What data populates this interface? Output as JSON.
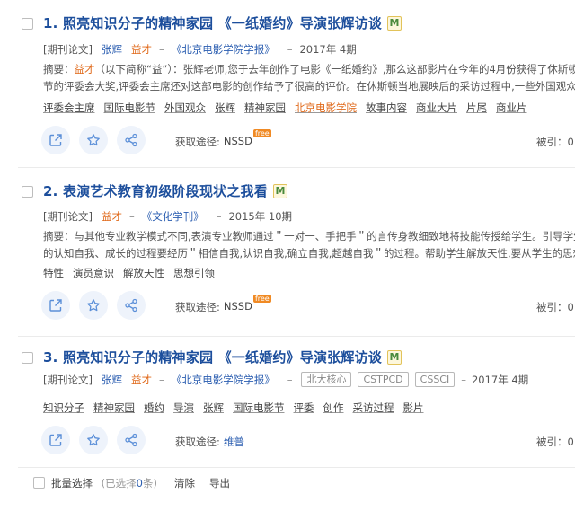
{
  "results": [
    {
      "title": "1. 照亮知识分子的精神家园 《一纸婚约》导演张辉访谈",
      "badge": "M",
      "type": "[期刊论文]",
      "authors": [
        "张辉",
        "益才"
      ],
      "journal": "《北京电影学院学报》",
      "year": "2017年 4期",
      "abstract_label": "摘要：",
      "abstract_hl": "益才",
      "abstract_line1": "（以下简称“益”）：张辉老师,您于去年创作了电影《一纸婚约》,那么这部影片在今年的4月份获得了休斯顿国际电影",
      "abstract_line2": "节的评委会大奖,评委会主席还对这部电影的创作给予了很高的评价。在休斯顿当地展映后的采访过程中,一些外国观众谈到吸引",
      "keywords": [
        "评委会主席",
        "国际电影节",
        "外国观众",
        "张辉",
        "精神家园",
        "北京电影学院",
        "故事内容",
        "商业大片",
        "片尾",
        "商业片"
      ],
      "source_label": "获取途径:",
      "source": "NSSD",
      "source_tag": "free",
      "cited": "被引：0"
    },
    {
      "title": "2. 表演艺术教育初级阶段现状之我看",
      "badge": "M",
      "type": "[期刊论文]",
      "authors": [
        "益才"
      ],
      "journal": "《文化学刊》",
      "year": "2015年 10期",
      "abstract_label": "摘要：",
      "abstract_line1": "与其他专业教学模式不同,表演专业教师通过＂一对一、手把手＂的言传身教细致地将技能传授给学生。引导学生明确演员",
      "abstract_line2": "的认知自我、成长的过程要经历＂相信自我,认识自我,确立自我,超越自我＂的过程。帮助学生解放天性,要从学生的思想、观念…",
      "keywords": [
        "特性",
        "演员意识",
        "解放天性",
        "思想引领"
      ],
      "source_label": "获取途径:",
      "source": "NSSD",
      "source_tag": "free",
      "cited": "被引：0"
    },
    {
      "title": "3. 照亮知识分子的精神家园 《一纸婚约》导演张辉访谈",
      "badge": "M",
      "type": "[期刊论文]",
      "authors": [
        "张辉",
        "益才"
      ],
      "journal": "《北京电影学院学报》",
      "index_badges": [
        "北大核心",
        "CSTPCD",
        "CSSCI"
      ],
      "year": "2017年 4期",
      "keywords": [
        "知识分子",
        "精神家园",
        "婚约",
        "导演",
        "张辉",
        "国际电影节",
        "评委",
        "创作",
        "采访过程",
        "影片"
      ],
      "source_label": "获取途径:",
      "source": "维普",
      "cited": "被引：0"
    }
  ],
  "bottom": {
    "batch_select": "批量选择",
    "selected_prefix": "(已选择",
    "selected_count": "0",
    "selected_suffix": "条)",
    "clear": "清除",
    "export": "导出"
  },
  "colors": {
    "title": "#1c4e9c",
    "link": "#2a5db0",
    "highlight": "#e06a1b",
    "free_tag": "#f08a24"
  },
  "icons": [
    "open-link-icon",
    "star-icon",
    "share-icon",
    "m-badge-icon"
  ]
}
